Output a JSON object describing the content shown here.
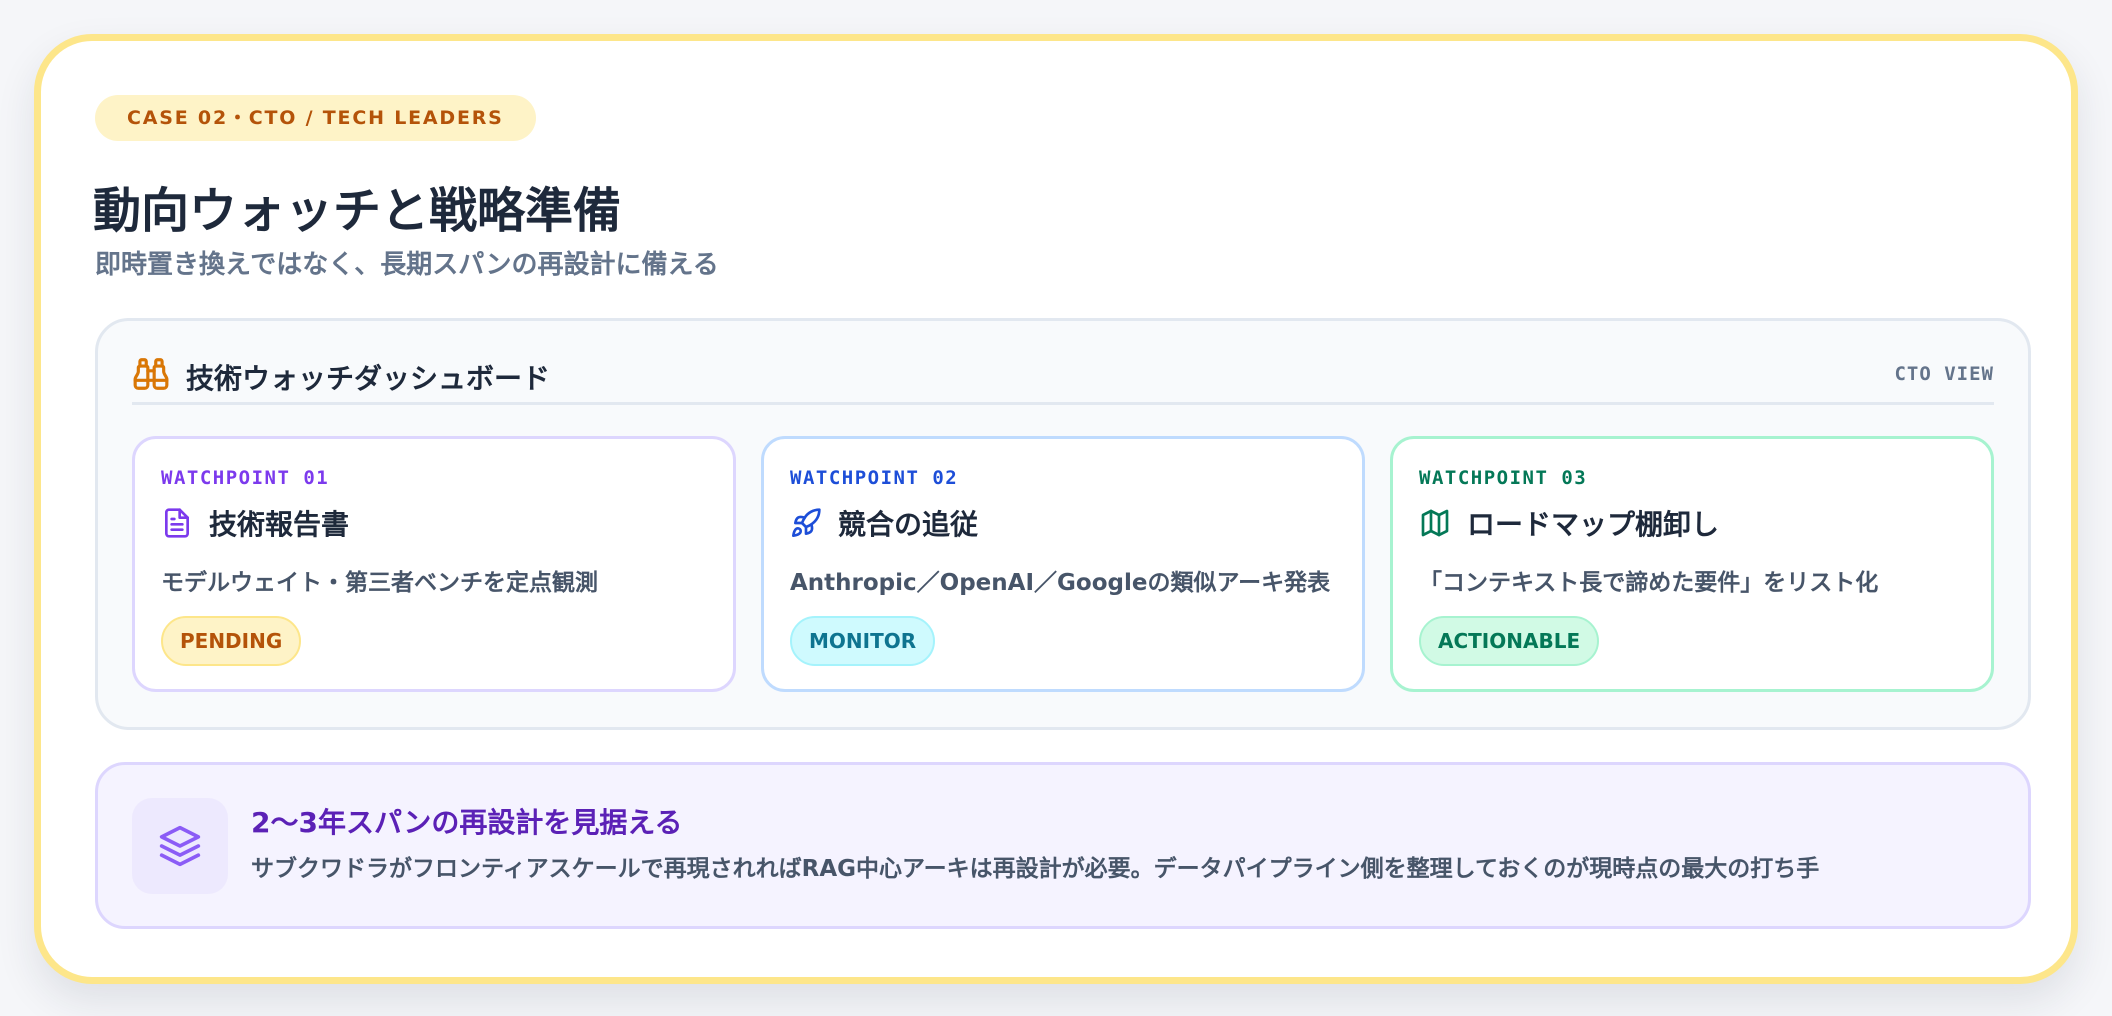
{
  "header": {
    "case_badge": "CASE 02・CTO / TECH LEADERS",
    "title": "動向ウォッチと戦略準備",
    "subtitle": "即時置き換えではなく、長期スパンの再設計に備える"
  },
  "dashboard": {
    "title": "技術ウォッチダッシュボード",
    "view_label": "CTO VIEW",
    "icon": "binoculars-icon",
    "watchpoints": [
      {
        "label": "WATCHPOINT 01",
        "icon": "document-icon",
        "title": "技術報告書",
        "description": "モデルウェイト・第三者ベンチを定点観測",
        "status": "PENDING",
        "accent": "#7c3aed"
      },
      {
        "label": "WATCHPOINT 02",
        "icon": "rocket-icon",
        "title": "競合の追従",
        "description": "Anthropic／OpenAI／Googleの類似アーキ発表",
        "status": "MONITOR",
        "accent": "#1d4ed8"
      },
      {
        "label": "WATCHPOINT 03",
        "icon": "map-icon",
        "title": "ロードマップ棚卸し",
        "description": "「コンテキスト長で諦めた要件」をリスト化",
        "status": "ACTIONABLE",
        "accent": "#047857"
      }
    ]
  },
  "insight": {
    "icon": "layers-icon",
    "title": "2〜3年スパンの再設計を見据える",
    "text": "サブクワドラがフロンティアスケールで再現されればRAG中心アーキは再設計が必要。データパイプライン側を整理しておくのが現時点の最大の打ち手"
  },
  "colors": {
    "border_accent": "#fde68a",
    "title": "#1e293b",
    "insight_title": "#5b21b6"
  }
}
